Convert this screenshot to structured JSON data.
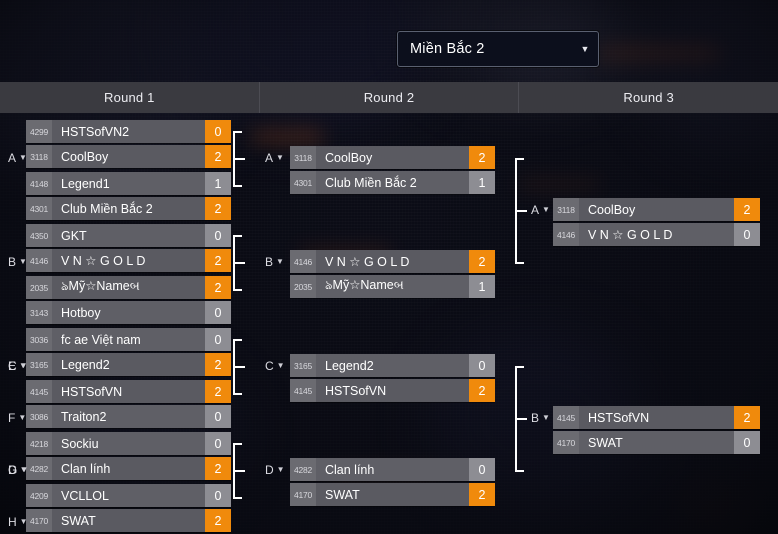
{
  "selector": {
    "value": "Miền Bắc 2",
    "caret": "chevron-down-icon"
  },
  "rounds": [
    {
      "label": "Round 1"
    },
    {
      "label": "Round 2"
    },
    {
      "label": "Round 3"
    }
  ],
  "round1": [
    {
      "group": "A",
      "rows": [
        {
          "seed": "4299",
          "name": "HSTSofVN2",
          "score": "0",
          "winner": false
        },
        {
          "seed": "3118",
          "name": "CoolBoy",
          "score": "2",
          "winner": true
        }
      ]
    },
    {
      "group": "B",
      "rows": [
        {
          "seed": "4148",
          "name": "Legend1",
          "score": "1",
          "winner": false
        },
        {
          "seed": "4301",
          "name": "Club Miền Bắc 2",
          "score": "2",
          "winner": true
        }
      ]
    },
    {
      "group": "C",
      "rows": [
        {
          "seed": "4350",
          "name": "GKT",
          "score": "0",
          "winner": false
        },
        {
          "seed": "4146",
          "name": "V N ☆ G O L D",
          "score": "2",
          "winner": true
        }
      ]
    },
    {
      "group": "D",
      "rows": [
        {
          "seed": "2035",
          "name": "ঌMỹ☆Nameબ",
          "score": "2",
          "winner": true
        },
        {
          "seed": "3143",
          "name": "Hotboy",
          "score": "0",
          "winner": false
        }
      ]
    },
    {
      "group": "E",
      "rows": [
        {
          "seed": "3036",
          "name": "fc ae Việt nam",
          "score": "0",
          "winner": false
        },
        {
          "seed": "3165",
          "name": "Legend2",
          "score": "2",
          "winner": true
        }
      ]
    },
    {
      "group": "F",
      "rows": [
        {
          "seed": "4145",
          "name": "HSTSofVN",
          "score": "2",
          "winner": true
        },
        {
          "seed": "3086",
          "name": "Traiton2",
          "score": "0",
          "winner": false
        }
      ]
    },
    {
      "group": "G",
      "rows": [
        {
          "seed": "4218",
          "name": "Sockiu",
          "score": "0",
          "winner": false
        },
        {
          "seed": "4282",
          "name": "Clan lính",
          "score": "2",
          "winner": true
        }
      ]
    },
    {
      "group": "H",
      "rows": [
        {
          "seed": "4209",
          "name": "VCLLOL",
          "score": "0",
          "winner": false
        },
        {
          "seed": "4170",
          "name": "SWAT",
          "score": "2",
          "winner": true
        }
      ]
    }
  ],
  "round2": [
    {
      "group": "A",
      "rows": [
        {
          "seed": "3118",
          "name": "CoolBoy",
          "score": "2",
          "winner": true
        },
        {
          "seed": "4301",
          "name": "Club Miền Bắc 2",
          "score": "1",
          "winner": false
        }
      ]
    },
    {
      "group": "B",
      "rows": [
        {
          "seed": "4146",
          "name": "V N ☆ G O L D",
          "score": "2",
          "winner": true
        },
        {
          "seed": "2035",
          "name": "ঌMỹ☆Nameબ",
          "score": "1",
          "winner": false
        }
      ]
    },
    {
      "group": "C",
      "rows": [
        {
          "seed": "3165",
          "name": "Legend2",
          "score": "0",
          "winner": false
        },
        {
          "seed": "4145",
          "name": "HSTSofVN",
          "score": "2",
          "winner": true
        }
      ]
    },
    {
      "group": "D",
      "rows": [
        {
          "seed": "4282",
          "name": "Clan lính",
          "score": "0",
          "winner": false
        },
        {
          "seed": "4170",
          "name": "SWAT",
          "score": "2",
          "winner": true
        }
      ]
    }
  ],
  "round3": [
    {
      "group": "A",
      "rows": [
        {
          "seed": "3118",
          "name": "CoolBoy",
          "score": "2",
          "winner": true
        },
        {
          "seed": "4146",
          "name": "V N ☆ G O L D",
          "score": "0",
          "winner": false
        }
      ]
    },
    {
      "group": "B",
      "rows": [
        {
          "seed": "4145",
          "name": "HSTSofVN",
          "score": "2",
          "winner": true
        },
        {
          "seed": "4170",
          "name": "SWAT",
          "score": "0",
          "winner": false
        }
      ]
    }
  ],
  "colors": {
    "winner": "#f08a0c",
    "header": "#3a3a40",
    "row": "#5f5f66",
    "connector": "#ffffff"
  }
}
